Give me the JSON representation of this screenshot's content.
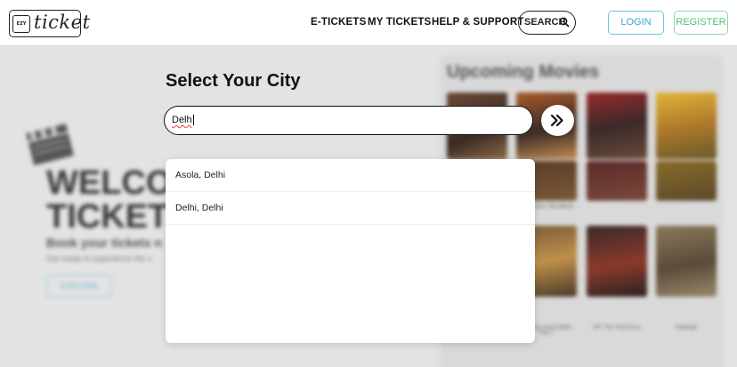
{
  "header": {
    "logo_badge": "EZY",
    "logo_word": "ticket",
    "nav": [
      "E-TICKETS",
      "MY TICKETS",
      "HELP & SUPPORT"
    ],
    "search_label": "SEARCH",
    "login_label": "LOGIN",
    "register_label": "REGISTER"
  },
  "hero": {
    "welcome_line1": "WELCO",
    "welcome_line2": "TICKET",
    "book_line": "Book your tickets n",
    "ready_line": "Get ready to experience the n",
    "explore_label": "EXPLORE"
  },
  "movies": {
    "title": "Upcoming Movies",
    "captions": [
      "",
      "Destination: Bloodlines",
      "Retro",
      "Bhool Chuk Maaf",
      "",
      "Hari Hara Veera Mallu - Part 1",
      "HIT: The Third Case",
      "Kapkapiii"
    ]
  },
  "city_select": {
    "title": "Select Your City",
    "input_value": "Delh",
    "suggestions": [
      "Asola, Delhi",
      "Delhi, Delhi"
    ]
  },
  "colors": {
    "login": "#33a9cf",
    "register": "#4fbf75",
    "spellcheck": "#e0413a"
  }
}
